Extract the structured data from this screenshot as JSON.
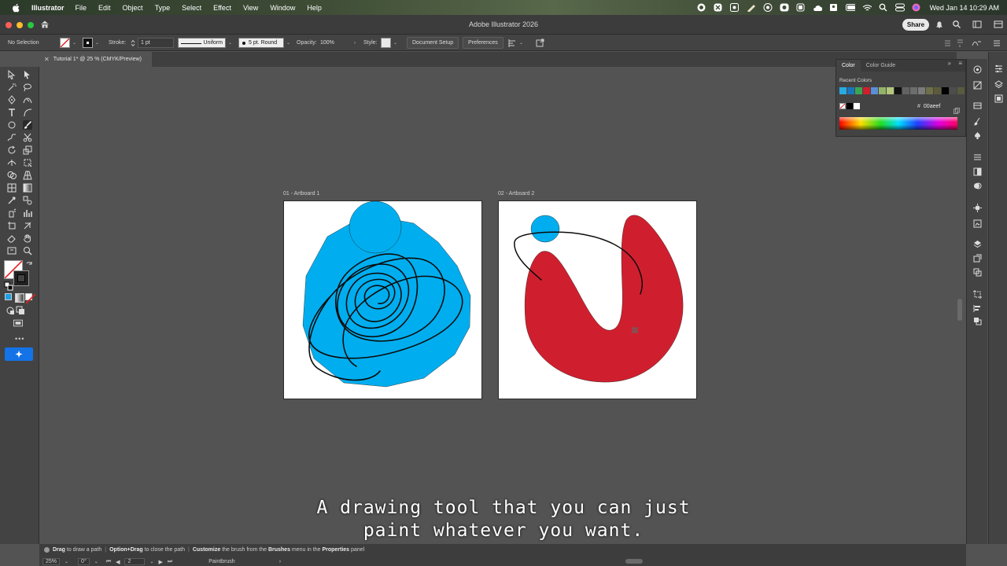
{
  "menubar": {
    "app_name": "Illustrator",
    "items": [
      "File",
      "Edit",
      "Object",
      "Type",
      "Select",
      "Effect",
      "View",
      "Window",
      "Help"
    ],
    "datetime": "Wed Jan 14  10:29 AM"
  },
  "window": {
    "title": "Adobe Illustrator 2026",
    "share_label": "Share"
  },
  "control_bar": {
    "selection": "No Selection",
    "stroke_label": "Stroke:",
    "stroke_weight": "1 pt",
    "profile": "Uniform",
    "brush": "5 pt. Round",
    "opacity_label": "Opacity:",
    "opacity_value": "100%",
    "style_label": "Style:",
    "document_setup": "Document Setup",
    "preferences": "Preferences"
  },
  "document": {
    "tab_title": "Tutorial 1* @ 25 % (CMYK/Preview)"
  },
  "artboards": [
    {
      "label": "01 - Artboard 1"
    },
    {
      "label": "02 - Artboard 2"
    }
  ],
  "color_panel": {
    "tabs": [
      "Color",
      "Color Guide"
    ],
    "recent_label": "Recent Colors",
    "hex_symbol": "#",
    "hex_value": "00aeef",
    "recent_colors": [
      "#29abe2",
      "#1b75bb",
      "#3aa655",
      "#d01f2e",
      "#5b8ed6",
      "#93b36b",
      "#b3c77a",
      "#111111",
      "#626262",
      "#6d6d6d",
      "#7b7b7b",
      "#6f6f4a",
      "#5c5c3c",
      "#000000",
      "#4d4d4d",
      "#5a5a3e"
    ],
    "fill_color": "#00aeef",
    "drawing_red": "#cf1f2e"
  },
  "statusbar": {
    "hint_parts": [
      {
        "bold": "Drag",
        "text": " to draw a path"
      },
      {
        "bold": "Option+Drag",
        "text": " to close the path"
      },
      {
        "bold": "Customize",
        "text": " the brush from the "
      },
      {
        "bold": "Brushes",
        "text": " menu in the "
      },
      {
        "bold": "Properties",
        "text": " panel"
      }
    ],
    "zoom": "25%",
    "rotation": "0°",
    "artboard_number": "2",
    "tool_name": "Paintbrush"
  },
  "caption": {
    "line1": "A drawing tool that you can just",
    "line2": "paint whatever you want."
  }
}
